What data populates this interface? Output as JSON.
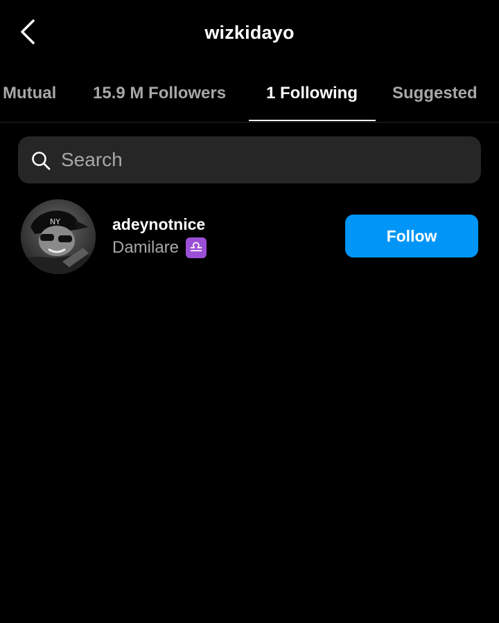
{
  "header": {
    "title": "wizkidayo",
    "back_icon": "chevron-left-icon"
  },
  "tabs": [
    {
      "label": "Mutual",
      "active": false
    },
    {
      "label": "15.9 M Followers",
      "active": false
    },
    {
      "label": "1 Following",
      "active": true
    },
    {
      "label": "Suggested",
      "active": false
    }
  ],
  "search": {
    "placeholder": "Search",
    "value": "",
    "icon": "search-icon"
  },
  "following": [
    {
      "username": "adeynotnice",
      "full_name": "Damilare",
      "emoji": "♎",
      "button_label": "Follow"
    }
  ],
  "colors": {
    "background": "#000000",
    "text_primary": "#ffffff",
    "text_secondary": "#a8a8a8",
    "search_bg": "#262626",
    "follow_button": "#0095f6",
    "zodiac_badge": "#9b4fd6"
  }
}
